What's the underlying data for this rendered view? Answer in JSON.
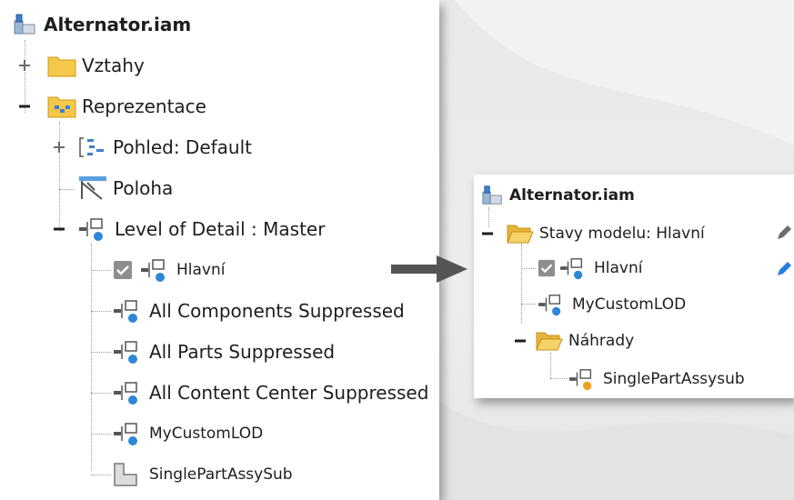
{
  "left_tree": {
    "root": "Alternator.iam",
    "items": [
      {
        "label": "Vztahy",
        "expander": "+"
      },
      {
        "label": "Reprezentace",
        "expander": "−"
      },
      {
        "label": "Pohled: Default",
        "expander": "+"
      },
      {
        "label": "Poloha"
      },
      {
        "label": "Level of Detail : Master",
        "expander": "−"
      },
      {
        "label": "Hlavní",
        "checked": true
      },
      {
        "label": "All Components Suppressed"
      },
      {
        "label": "All Parts Suppressed"
      },
      {
        "label": "All Content Center Suppressed"
      },
      {
        "label": "MyCustomLOD"
      },
      {
        "label": "SinglePartAssySub"
      }
    ]
  },
  "right_tree": {
    "root": "Alternator.iam",
    "items": [
      {
        "label": "Stavy modelu: Hlavní",
        "expander": "−"
      },
      {
        "label": "Hlavní",
        "checked": true
      },
      {
        "label": "MyCustomLOD"
      },
      {
        "label": "Náhrady",
        "expander": "−"
      },
      {
        "label": "SinglePartAssysub"
      }
    ]
  },
  "colors": {
    "folder": "#f3c84b",
    "folder_edge": "#d19a12",
    "lod_blue": "#2e86d6",
    "substitute_orange": "#f0a020",
    "arrow": "#555555",
    "pencil": "#1f7fe0"
  }
}
